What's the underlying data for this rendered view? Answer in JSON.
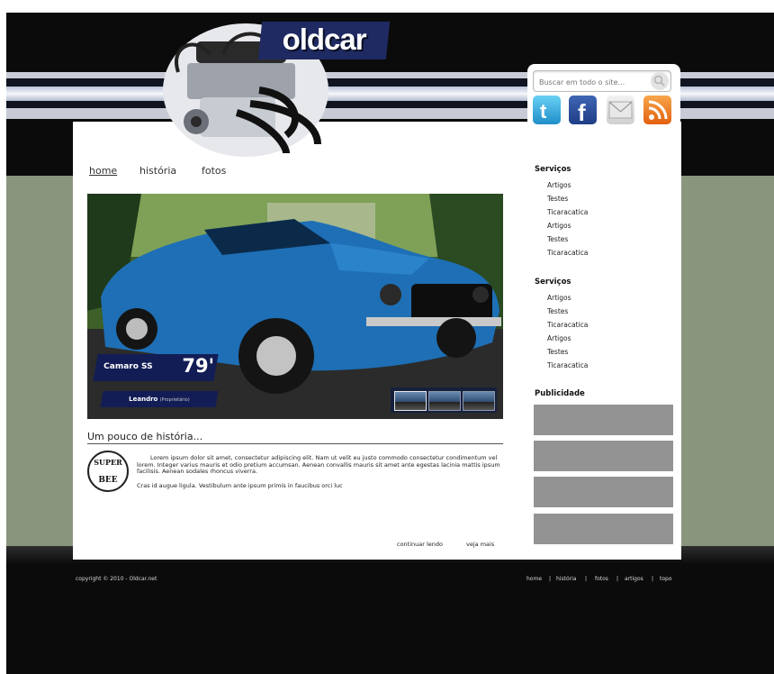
{
  "brand": {
    "logo_text": "oldcar"
  },
  "search": {
    "placeholder": "Buscar em todo o site..."
  },
  "social": [
    "twitter-icon",
    "facebook-icon",
    "mail-icon",
    "rss-icon"
  ],
  "nav": {
    "home": "home",
    "historia": "história",
    "fotos": "fotos"
  },
  "hero": {
    "car_name": "Camaro SS",
    "car_year": "79'",
    "owner_name": "Leandro",
    "owner_role": "(Proprietário)"
  },
  "article": {
    "title": "Um pouco de história...",
    "badge_top": "SUPER",
    "badge_bottom": "BEE",
    "paragraph1": "Lorem ipsum dolor sit amet, consectetur adipiscing elit. Nam ut velit eu justo commodo consectetur condimentum vel lorem. Integer varius mauris et odio pretium accumsan. Aenean convallis mauris sit amet ante egestas lacinia mattis ipsum facilisis. Aenean sodales rhoncus viverra.",
    "paragraph2": "Cras id augue ligula. Vestibulum ante ipsum primis in faucibus orci luc",
    "continue_link": "continuar lendo",
    "more_link": "veja mais"
  },
  "sidebar": {
    "group1": {
      "title": "Serviços",
      "items": [
        "Artigos",
        "Testes",
        "Ticaracatica",
        "Artigos",
        "Testes",
        "Ticaracatica"
      ]
    },
    "group2": {
      "title": "Serviços",
      "items": [
        "Artigos",
        "Testes",
        "Ticaracatica",
        "Artigos",
        "Testes",
        "Ticaracatica"
      ]
    },
    "ads_title": "Publicidade"
  },
  "footer": {
    "copyright": "copyright © 2010 - Oldcar.net",
    "links": [
      "home",
      "história",
      "fotos",
      "artigos",
      "topo"
    ],
    "separator": "|"
  },
  "colors": {
    "navy": "#131d55",
    "ad_gray": "#939393",
    "grass": "#8a957e"
  }
}
